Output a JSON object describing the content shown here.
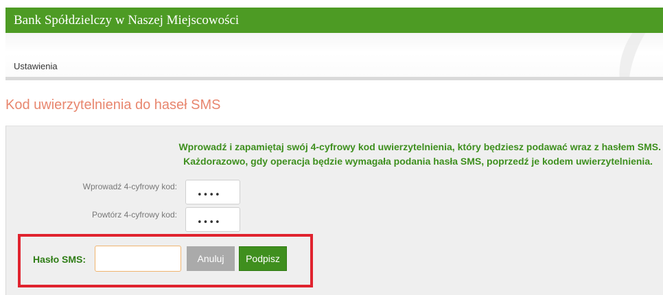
{
  "header": {
    "bank_name": "Bank Spółdzielczy w Naszej Miejscowości",
    "background_color": "#4d9b24"
  },
  "nav": {
    "items": [
      {
        "label": "Ustawienia"
      }
    ]
  },
  "page": {
    "title": "Kod uwierzytelnienia do haseł SMS",
    "title_color": "#e8866e"
  },
  "form": {
    "info_lines": [
      "Wprowadź i zapamiętaj swój 4-cyfrowy kod uwierzytelnienia, który będziesz podawać wraz z hasłem SMS.",
      "Każdorazowo, gdy operacja będzie wymagała podania hasła SMS, poprzedź je kodem uwierzytelnienia."
    ],
    "code_label": "Wprowadź 4-cyfrowy kod:",
    "code_value": "••••",
    "repeat_label": "Powtórz 4-cyfrowy kod:",
    "repeat_value": "••••",
    "sms_label": "Hasło SMS:",
    "sms_value": "",
    "cancel_label": "Anuluj",
    "sign_label": "Podpisz",
    "highlight_color": "#e0232e",
    "accent_color": "#3f8f1e"
  }
}
